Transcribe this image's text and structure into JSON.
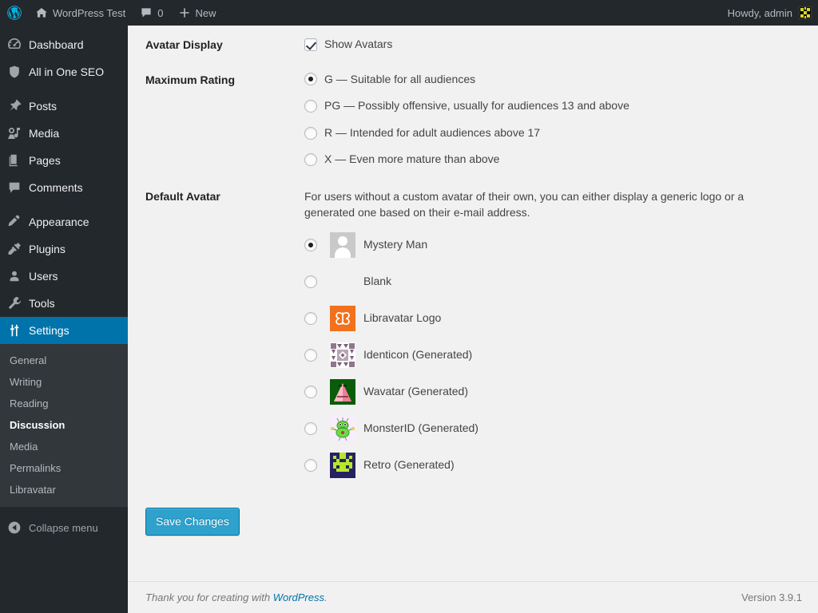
{
  "adminbar": {
    "site_title": "WordPress Test",
    "comments_count": "0",
    "new_label": "New",
    "howdy": "Howdy, admin",
    "icons": {
      "wp_logo": "wordpress-logo-icon",
      "home": "home-icon",
      "comment": "comment-bubble-icon",
      "plus": "plus-icon",
      "avatar": "user-avatar"
    }
  },
  "sidebar": {
    "items": [
      {
        "label": "Dashboard",
        "icon": "dashboard-icon",
        "current": false
      },
      {
        "label": "All in One SEO",
        "icon": "shield-icon",
        "current": false
      },
      {
        "label": "Posts",
        "icon": "pin-icon",
        "current": false
      },
      {
        "label": "Media",
        "icon": "media-icon",
        "current": false
      },
      {
        "label": "Pages",
        "icon": "pages-icon",
        "current": false
      },
      {
        "label": "Comments",
        "icon": "comment-bubble-icon",
        "current": false
      },
      {
        "label": "Appearance",
        "icon": "paintbrush-icon",
        "current": false
      },
      {
        "label": "Plugins",
        "icon": "plug-icon",
        "current": false
      },
      {
        "label": "Users",
        "icon": "user-icon",
        "current": false
      },
      {
        "label": "Tools",
        "icon": "wrench-icon",
        "current": false
      },
      {
        "label": "Settings",
        "icon": "settings-sliders-icon",
        "current": true
      }
    ],
    "submenu": [
      {
        "label": "General",
        "current": false
      },
      {
        "label": "Writing",
        "current": false
      },
      {
        "label": "Reading",
        "current": false
      },
      {
        "label": "Discussion",
        "current": true
      },
      {
        "label": "Media",
        "current": false
      },
      {
        "label": "Permalinks",
        "current": false
      },
      {
        "label": "Libravatar",
        "current": false
      }
    ],
    "collapse_label": "Collapse menu",
    "collapse_icon": "collapse-arrow-icon",
    "active_color": "#0073aa",
    "background_color": "#23282d",
    "submenu_background": "#32373c"
  },
  "settings": {
    "avatar_display": {
      "label": "Avatar Display",
      "checkbox_label": "Show Avatars",
      "checked": true
    },
    "maximum_rating": {
      "label": "Maximum Rating",
      "selected": "G",
      "options": [
        {
          "value": "G",
          "label": "G — Suitable for all audiences",
          "checked": true
        },
        {
          "value": "PG",
          "label": "PG — Possibly offensive, usually for audiences 13 and above",
          "checked": false
        },
        {
          "value": "R",
          "label": "R — Intended for adult audiences above 17",
          "checked": false
        },
        {
          "value": "X",
          "label": "X — Even more mature than above",
          "checked": false
        }
      ]
    },
    "default_avatar": {
      "label": "Default Avatar",
      "description": "For users without a custom avatar of their own, you can either display a generic logo or a generated one based on their e-mail address.",
      "selected": "Mystery Man",
      "options": [
        {
          "label": "Mystery Man",
          "avatar": "mystery-man-avatar",
          "checked": true
        },
        {
          "label": "Blank",
          "avatar": "blank-avatar",
          "checked": false
        },
        {
          "label": "Libravatar Logo",
          "avatar": "libravatar-logo",
          "checked": false
        },
        {
          "label": "Identicon (Generated)",
          "avatar": "identicon-avatar",
          "checked": false
        },
        {
          "label": "Wavatar (Generated)",
          "avatar": "wavatar-avatar",
          "checked": false
        },
        {
          "label": "MonsterID (Generated)",
          "avatar": "monsterid-avatar",
          "checked": false
        },
        {
          "label": "Retro (Generated)",
          "avatar": "retro-avatar",
          "checked": false
        }
      ]
    },
    "save_label": "Save Changes",
    "save_color": "#2ea2cc"
  },
  "footer": {
    "thanks_prefix": "Thank you for creating with ",
    "link_label": "WordPress",
    "thanks_suffix": ".",
    "version": "Version 3.9.1"
  }
}
